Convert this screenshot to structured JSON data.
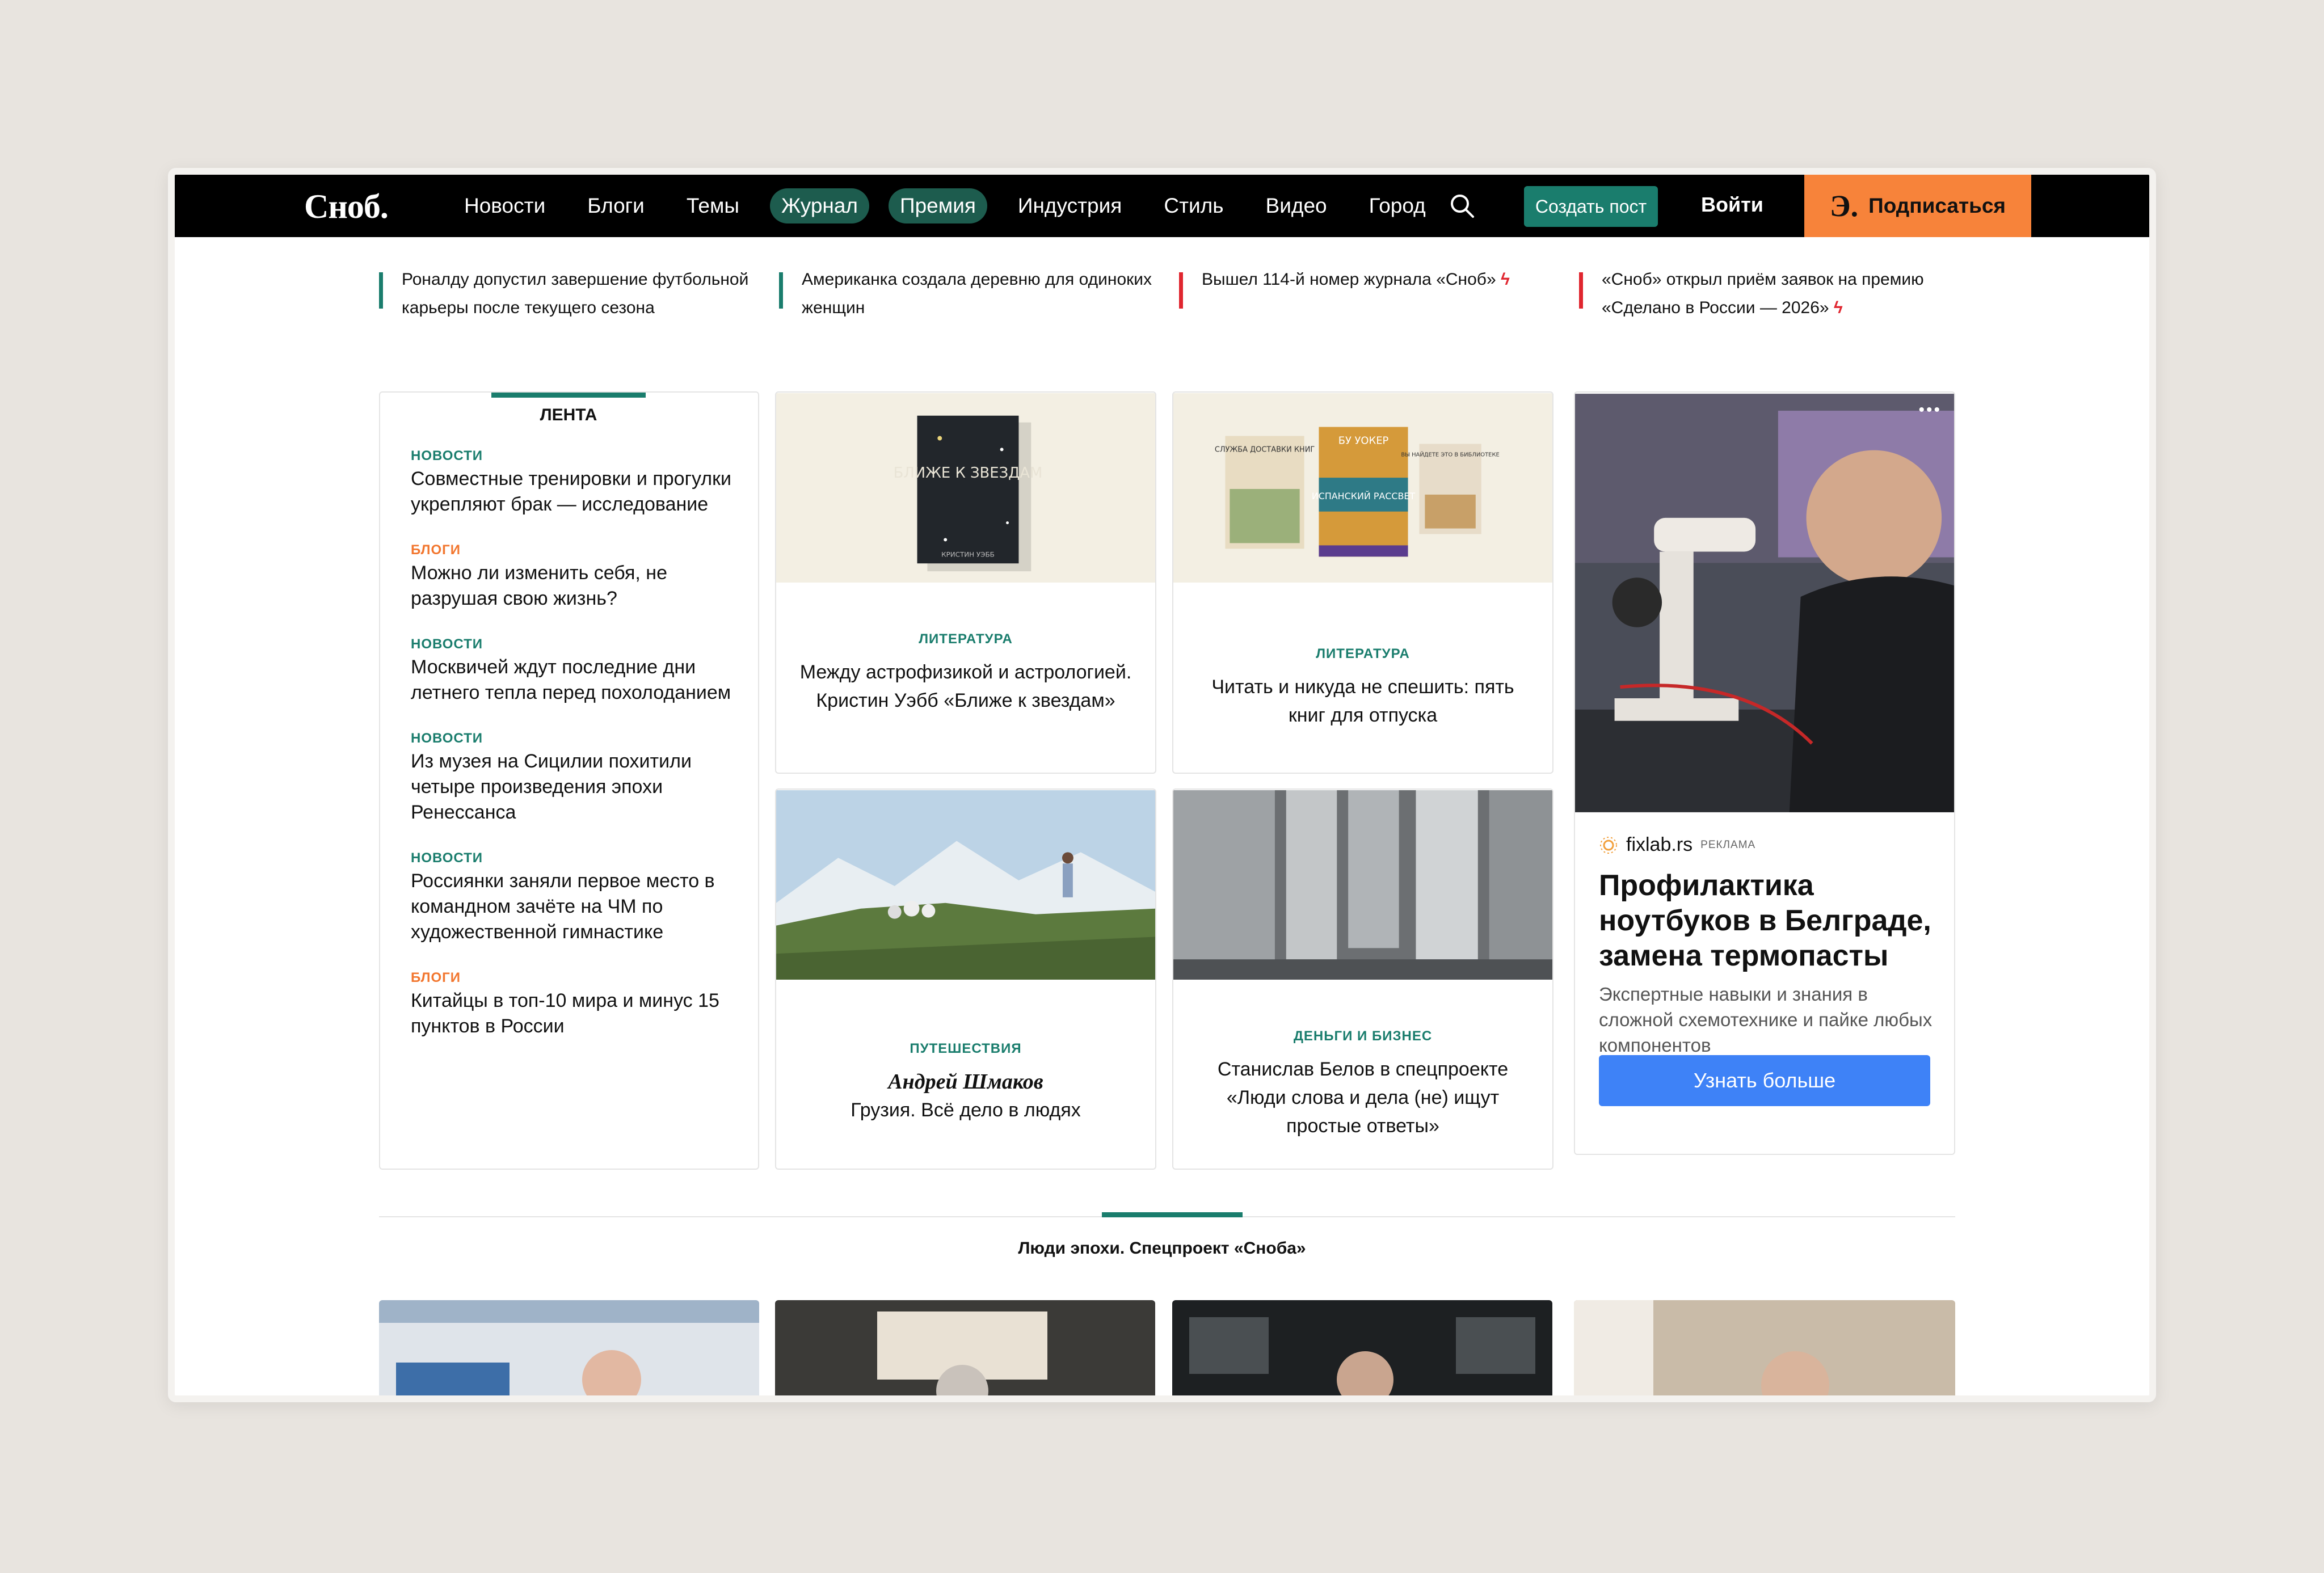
{
  "header": {
    "logo": "Сноб.",
    "nav": [
      "Новости",
      "Блоги",
      "Темы",
      "Журнал",
      "Премия",
      "Индустрия",
      "Стиль",
      "Видео",
      "Город"
    ],
    "create_post": "Создать пост",
    "login": "Войти",
    "subscribe": "Подписаться",
    "subscribe_glyph": "Э."
  },
  "ticker": [
    {
      "text": "Роналду допустил завершение футбольной карьеры после текущего сезона",
      "bolt": ""
    },
    {
      "text": "Американка создала деревню для одиноких женщин",
      "bolt": ""
    },
    {
      "text": "Вышел 114-й номер журнала «Сноб»",
      "bolt": "ϟ"
    },
    {
      "text": "«Сноб» открыл приём заявок на премию «Сделано в России — 2026»",
      "bolt": "ϟ"
    }
  ],
  "feed": {
    "title": "ЛЕНТА",
    "items": [
      {
        "category": "НОВОСТИ",
        "title": "Совместные тренировки и прогулки укрепляют брак — исследование"
      },
      {
        "category": "БЛОГИ",
        "title": "Можно ли изменить себя, не разрушая свою жизнь?"
      },
      {
        "category": "НОВОСТИ",
        "title": "Москвичей ждут последние дни летнего тепла перед похолоданием"
      },
      {
        "category": "НОВОСТИ",
        "title": "Из музея на Сицилии похитили четыре произведения эпохи Ренессанса"
      },
      {
        "category": "НОВОСТИ",
        "title": "Россиянки заняли первое место в командном зачёте на ЧМ по художественной гимнастике"
      },
      {
        "category": "БЛОГИ",
        "title": "Китайцы в топ-10 мира и минус 15 пунктов в России"
      }
    ]
  },
  "cards": {
    "book1": {
      "category": "ЛИТЕРАТУРА",
      "title": "Между астрофизикой и астрологией. Кристин Уэбб «Ближе к звездам»",
      "cover_text": "БЛИЖЕ К ЗВЕЗДАМ",
      "cover_author": "КРИСТИН УЭББ"
    },
    "books": {
      "category": "ЛИТЕРАТУРА",
      "title": "Читать и никуда не спешить: пять книг для отпуска",
      "cover1": "СЛУЖБА ДОСТАВКИ КНИГ",
      "cover2_author": "БУ УОКЕР",
      "cover2": "ИСПАНСКИЙ РАССВЕТ",
      "cover3": "ВЫ НАЙДЕТЕ ЭТО В БИБЛИОТЕКЕ"
    },
    "travel": {
      "category": "ПУТЕШЕСТВИЯ",
      "author": "Андрей Шмаков",
      "title": "Грузия. Всё дело в людях"
    },
    "business": {
      "category": "ДЕНЬГИ И БИЗНЕС",
      "title": "Станислав Белов в спецпроекте «Люди слова и дела (не) ищут простые ответы»"
    }
  },
  "ad": {
    "menu": "•••",
    "brand": "fixlab.rs",
    "tag": "РЕКЛАМА",
    "title": "Профилактика ноутбуков в Белграде, замена термопасты",
    "subtitle": "Экспертные навыки и знания в сложной схемотехнике и пайке любых компонентов",
    "button": "Узнать больше"
  },
  "section": {
    "title": "Люди эпохи. Спецпроект «Сноба»"
  },
  "colors": {
    "accent": "#1a7d6d",
    "blogs": "#f2762e",
    "subscribe": "#f7833a",
    "ad_button": "#3e82f7",
    "ticker_red": "#e0262f"
  }
}
